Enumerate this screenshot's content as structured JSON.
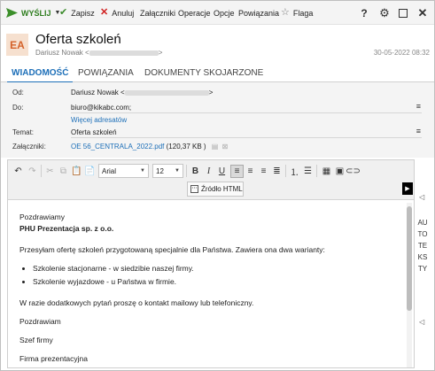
{
  "toolbar": {
    "send_label": "WYŚLIJ",
    "save_label": "Zapisz",
    "cancel_label": "Anuluj",
    "attachments_label": "Załączniki",
    "operations_label": "Operacje",
    "options_label": "Opcje",
    "links_label": "Powiązania",
    "flag_label": "Flaga",
    "icons": [
      "send-icon",
      "save-icon",
      "cancel-icon",
      "attachment-icon",
      "link-icon",
      "flag-star-icon",
      "help-icon",
      "gear-icon",
      "maximize-icon",
      "close-icon"
    ]
  },
  "header": {
    "avatar_initials": "EA",
    "title": "Oferta szkoleń",
    "sender_name": "Dariusz Nowak",
    "date": "30-05-2022 08:32"
  },
  "tabs": [
    {
      "label": "WIADOMOŚĆ",
      "active": true
    },
    {
      "label": "POWIĄZANIA",
      "active": false
    },
    {
      "label": "DOKUMENTY SKOJARZONE",
      "active": false
    }
  ],
  "form": {
    "from_label": "Od:",
    "from_value": "Dariusz Nowak",
    "to_label": "Do:",
    "to_value": "biuro@kikabc.com;",
    "more_addresses": "Więcej adresatów",
    "subject_label": "Temat:",
    "subject_value": "Oferta szkoleń",
    "attachments_label": "Załączniki:",
    "attachment_name": "OE 56_CENTRALA_2022.pdf",
    "attachment_size": "(120,37 KB )"
  },
  "editor": {
    "font_family": "Arial",
    "font_size": "12",
    "source_button": "Źródło HTML",
    "body": {
      "greeting": "Pozdrawiamy",
      "company": "PHU Prezentacja sp. z o.o.",
      "intro": "Przesyłam ofertę szkoleń przygotowaną specjalnie dla Państwa. Zawiera ona dwa warianty:",
      "bullets": [
        "Szkolenie stacjonarne - w siedzibie naszej firmy.",
        "Szkolenie wyjazdowe - u Państwa w firmie."
      ],
      "contact": "W razie dodatkowych pytań proszę o kontakt mailowy lub telefoniczny.",
      "regards": "Pozdrawiam",
      "signature_role": "Szef firmy",
      "signature_company": "Firma prezentacyjna"
    }
  },
  "side_panel": {
    "label": "AUTOTEKSTY"
  }
}
